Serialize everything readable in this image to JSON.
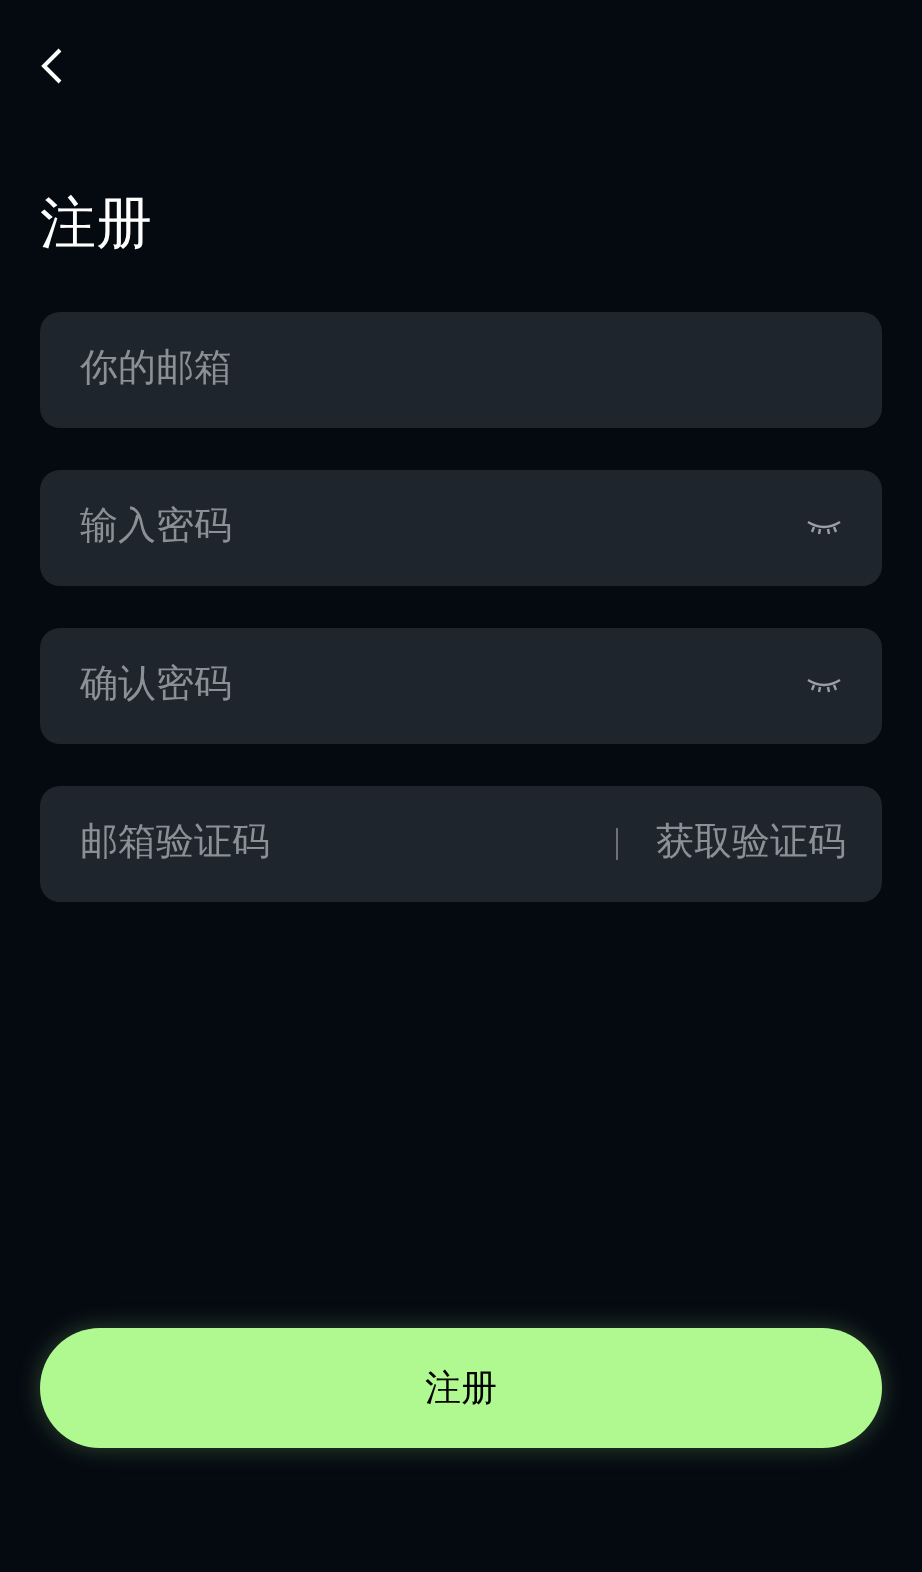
{
  "title": "注册",
  "fields": [
    {
      "kind": "text",
      "placeholder": "你的邮箱"
    },
    {
      "kind": "password",
      "placeholder": "输入密码"
    },
    {
      "kind": "password",
      "placeholder": "确认密码"
    },
    {
      "kind": "code",
      "placeholder": "邮箱验证码",
      "action": "获取验证码"
    }
  ],
  "submit": "注册"
}
